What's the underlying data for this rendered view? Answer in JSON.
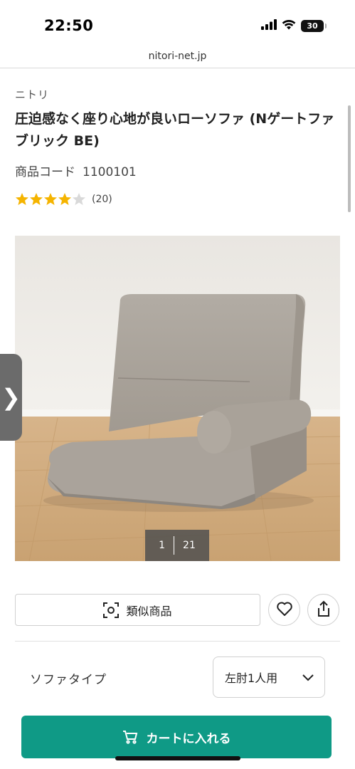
{
  "status_bar": {
    "time": "22:50",
    "battery": "30"
  },
  "browser": {
    "url": "nitori-net.jp"
  },
  "product": {
    "brand": "ニトリ",
    "title": "圧迫感なく座り心地が良いローソファ (Nゲートファブリック BE)",
    "code_label": "商品コード",
    "code_value": "1100101",
    "rating_value": 4,
    "rating_max": 5,
    "review_count": "(20)"
  },
  "gallery": {
    "current": "1",
    "total": "21"
  },
  "side_tab": {
    "glyph": "❯"
  },
  "actions": {
    "similar_label": "類似商品",
    "favorite_icon": "heart-icon",
    "share_icon": "share-icon"
  },
  "options": {
    "sofa_type_label": "ソファタイプ",
    "sofa_type_value": "左肘1人用"
  },
  "cart": {
    "label": "カートに入れる"
  },
  "colors": {
    "accent": "#0f9a86",
    "star": "#f5b400",
    "star_empty": "#d9d9d9"
  }
}
